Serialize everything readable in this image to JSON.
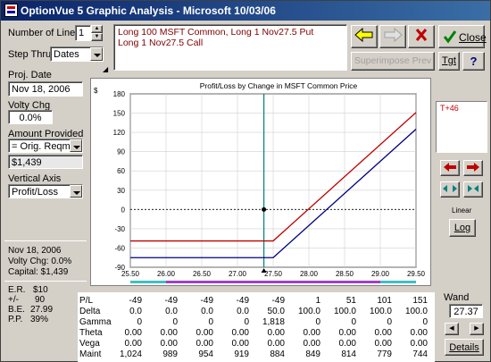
{
  "window": {
    "title": "OptionVue 5 Graphic Analysis - Microsoft   10/03/06"
  },
  "controls": {
    "number_of_lines_label": "Number of Lines",
    "number_of_lines_value": "1",
    "step_thru_label": "Step Thru",
    "step_thru_value": "Dates",
    "proj_date_label": "Proj. Date",
    "proj_date_value": "Nov 18, 2006",
    "volty_chg_label": "Volty Chg",
    "volty_chg_value": "0.0%",
    "amount_provided_label": "Amount Provided",
    "amount_provided_value": "= Orig. Reqmt.",
    "amount_value": "$1,439",
    "vertical_axis_label": "Vertical Axis",
    "vertical_axis_value": "Profit/Loss"
  },
  "positions": {
    "line1": "Long 100 MSFT Common, Long 1 Nov27.5 Put",
    "line2": "Long 1 Nov27.5 Call"
  },
  "toolbar": {
    "close_label": "Close",
    "superimpose_label": "Superimpose Prev",
    "tgt_label": "Tgt",
    "help_label": "?",
    "linear_label": "Linear",
    "log_label": "Log",
    "details_label": "Details",
    "wand_label": "Wand",
    "wand_value": "27.37",
    "t_marker": "T+46"
  },
  "summary": {
    "date": "Nov 18, 2006",
    "volty": "Volty Chg: 0.0%",
    "capital": "Capital: $1,439",
    "er_label": "E.R.",
    "er_value": "$10",
    "pm_label": "+/-",
    "pm_value": "90",
    "be_label": "B.E.",
    "be_value": "27.99",
    "pp_label": "P.P.",
    "pp_value": "39%"
  },
  "chart_data": {
    "type": "line",
    "title": "Profit/Loss by Change in MSFT Common Price",
    "ylabel": "$",
    "xlabel": "",
    "xlim": [
      25.5,
      29.5
    ],
    "ylim": [
      -90,
      180
    ],
    "x_ticks": [
      "25.50",
      "26.00",
      "26.50",
      "27.00",
      "27.50",
      "28.00",
      "28.50",
      "29.00",
      "29.50"
    ],
    "y_ticks": [
      "180",
      "150",
      "120",
      "90",
      "60",
      "30",
      "0",
      "-30",
      "-60",
      "-90"
    ],
    "wand_x": 27.37,
    "series": [
      {
        "color": "#c00000",
        "x": [
          25.5,
          27.5,
          29.5
        ],
        "y": [
          -49,
          -49,
          151
        ]
      },
      {
        "color": "#000080",
        "x": [
          25.5,
          27.5,
          29.5
        ],
        "y": [
          -75,
          -75,
          125
        ]
      }
    ],
    "dot": {
      "x": 27.37,
      "y": 0
    }
  },
  "table": {
    "rows": [
      {
        "label": "P/L",
        "values": [
          "-49",
          "-49",
          "-49",
          "-49",
          "-49",
          "1",
          "51",
          "101",
          "151"
        ]
      },
      {
        "label": "Delta",
        "values": [
          "0.0",
          "0.0",
          "0.0",
          "0.0",
          "50.0",
          "100.0",
          "100.0",
          "100.0",
          "100.0"
        ]
      },
      {
        "label": "Gamma",
        "values": [
          "0",
          "0",
          "0",
          "0",
          "1,818",
          "0",
          "0",
          "0",
          "0"
        ]
      },
      {
        "label": "Theta",
        "values": [
          "0.00",
          "0.00",
          "0.00",
          "0.00",
          "0.00",
          "0.00",
          "0.00",
          "0.00",
          "0.00"
        ]
      },
      {
        "label": "Vega",
        "values": [
          "0.00",
          "0.00",
          "0.00",
          "0.00",
          "0.00",
          "0.00",
          "0.00",
          "0.00",
          "0.00"
        ]
      },
      {
        "label": "Maint",
        "values": [
          "1,024",
          "989",
          "954",
          "919",
          "884",
          "849",
          "814",
          "779",
          "744"
        ]
      }
    ]
  }
}
